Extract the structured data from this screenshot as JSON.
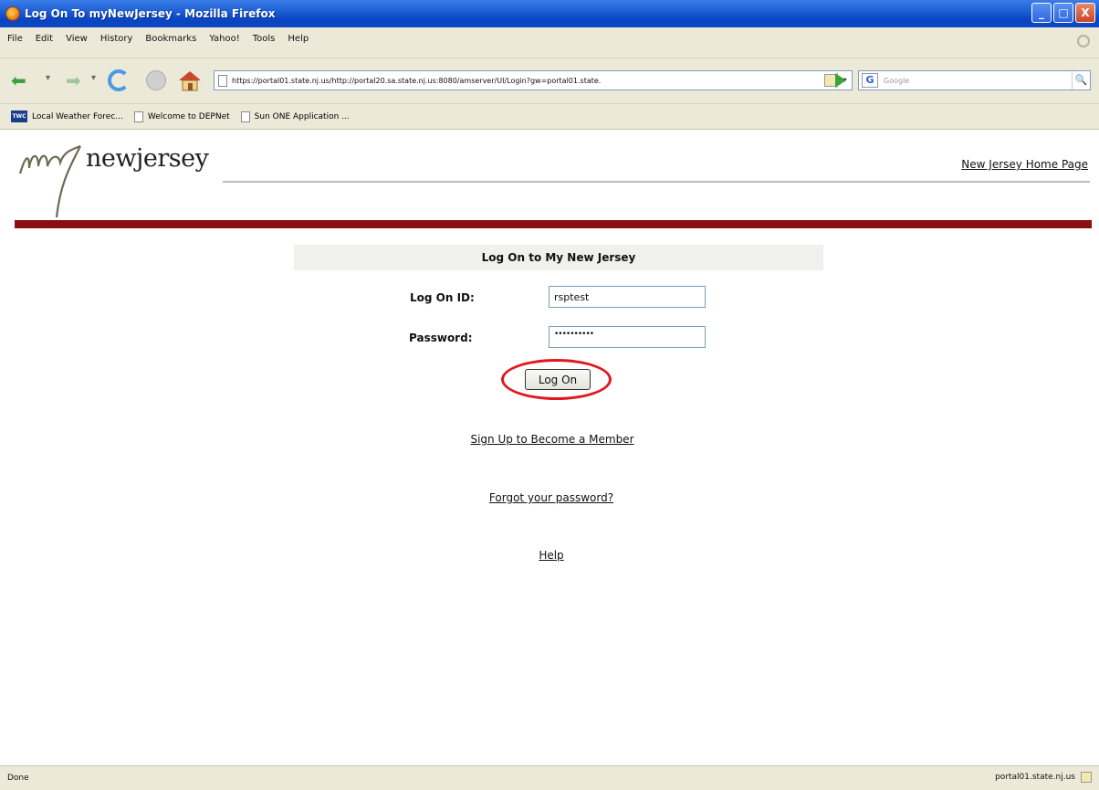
{
  "window": {
    "title": "Log On To myNewJersey - Mozilla Firefox",
    "buttons": [
      "_",
      "□",
      "X"
    ]
  },
  "menu": [
    "File",
    "Edit",
    "View",
    "History",
    "Bookmarks",
    "Yahoo!",
    "Tools",
    "Help"
  ],
  "navbar": {
    "url": "https://portal01.state.nj.us/http://portal20.sa.state.nj.us:8080/amserver/UI/Login?gw=portal01.state.",
    "search_placeholder": "Google",
    "search_engine_letter": "G"
  },
  "bookmarks": [
    {
      "label": "Local Weather Forec...",
      "icon": "twc-icon",
      "icon_text": "TWC"
    },
    {
      "label": "Welcome to DEPNet",
      "icon": "page-icon"
    },
    {
      "label": "Sun ONE Application ...",
      "icon": "page-icon"
    }
  ],
  "page": {
    "logo_text": "newjersey",
    "home_link": "New Jersey Home Page",
    "form_title": "Log On to My New Jersey",
    "logon_id_label": "Log On ID:",
    "logon_id_value": "rsptest",
    "password_label": "Password:",
    "password_value": "••••••••••",
    "logon_button": "Log On",
    "signup_link": "Sign Up to Become a Member",
    "forgot_link": "Forgot your password?",
    "help_link": "Help"
  },
  "status": {
    "left": "Done",
    "right": "portal01.state.nj.us"
  },
  "colors": {
    "brand_rule": "#8b0f12",
    "highlight_circle": "#e1171e",
    "titlebar": "#0a45c4"
  }
}
